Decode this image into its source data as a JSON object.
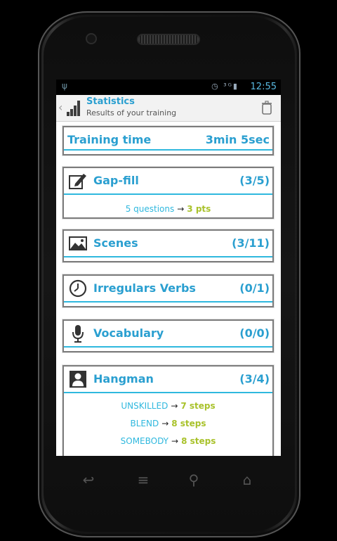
{
  "status_bar": {
    "time": "12:55",
    "icons": "◷ ³ᴳ▮"
  },
  "action_bar": {
    "title": "Statistics",
    "subtitle": "Results of your training"
  },
  "training": {
    "label": "Training time",
    "value": "3min 5sec"
  },
  "sections": [
    {
      "label": "Gap-fill",
      "score": "(3/5)",
      "icon": "pencil-icon",
      "rows": [
        {
          "left": "5 questions",
          "arrow": "→",
          "right": "3 pts"
        }
      ]
    },
    {
      "label": "Scenes",
      "score": "(3/11)",
      "icon": "image-icon"
    },
    {
      "label": "Irregulars Verbs",
      "score": "(0/1)",
      "icon": "clock-icon"
    },
    {
      "label": "Vocabulary",
      "score": "(0/0)",
      "icon": "microphone-icon"
    },
    {
      "label": "Hangman",
      "score": "(3/4)",
      "icon": "person-icon",
      "rows": [
        {
          "left": "UNSKILLED",
          "arrow": "→",
          "right": "7 steps"
        },
        {
          "left": "BLEND",
          "arrow": "→",
          "right": "8 steps"
        },
        {
          "left": "SOMEBODY",
          "arrow": "→",
          "right": "8 steps"
        }
      ]
    }
  ],
  "colors": {
    "accent": "#2a9fd0",
    "rule": "#2fb8de",
    "points": "#a9c22b"
  }
}
